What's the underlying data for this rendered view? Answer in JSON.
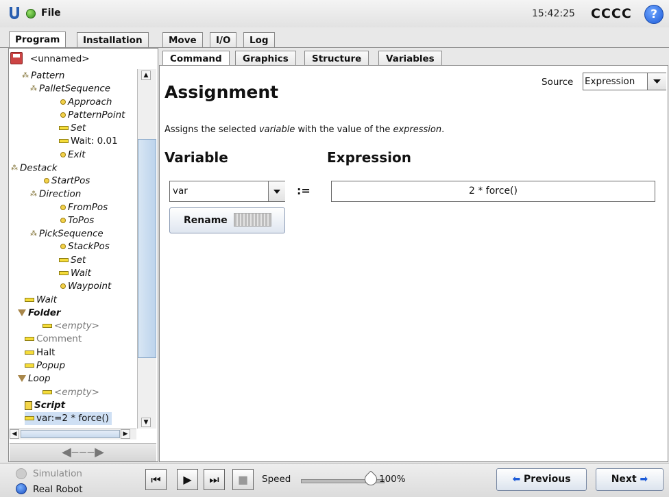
{
  "app": {
    "menu_file": "File",
    "clock": "15:42:25",
    "robot_name": "CCCC",
    "help": "?"
  },
  "main_tabs": [
    "Program",
    "Installation",
    "Move",
    "I/O",
    "Log"
  ],
  "program": {
    "name": "<unnamed>"
  },
  "tree": [
    {
      "label": "Pattern",
      "icon": "pattern-icon",
      "style": "italic"
    },
    {
      "label": "PalletSequence",
      "icon": "pattern-icon",
      "style": "italic"
    },
    {
      "label": "Approach",
      "icon": "waypoint-icon",
      "style": "italic"
    },
    {
      "label": "PatternPoint",
      "icon": "waypoint-icon",
      "style": "italic"
    },
    {
      "label": "Set",
      "icon": "command-icon",
      "style": "italic"
    },
    {
      "label": "Wait: 0.01",
      "icon": "command-icon",
      "style": "normal"
    },
    {
      "label": "Exit",
      "icon": "waypoint-icon",
      "style": "italic"
    },
    {
      "label": "Destack",
      "icon": "pattern-icon",
      "style": "italic"
    },
    {
      "label": "StartPos",
      "icon": "waypoint-icon",
      "style": "italic"
    },
    {
      "label": "Direction",
      "icon": "pattern-icon",
      "style": "italic"
    },
    {
      "label": "FromPos",
      "icon": "waypoint-icon",
      "style": "italic"
    },
    {
      "label": "ToPos",
      "icon": "waypoint-icon",
      "style": "italic"
    },
    {
      "label": "PickSequence",
      "icon": "pattern-icon",
      "style": "italic"
    },
    {
      "label": "StackPos",
      "icon": "waypoint-icon",
      "style": "italic"
    },
    {
      "label": "Set",
      "icon": "command-icon",
      "style": "italic"
    },
    {
      "label": "Wait",
      "icon": "command-icon",
      "style": "italic"
    },
    {
      "label": "Waypoint",
      "icon": "waypoint-icon",
      "style": "italic"
    },
    {
      "label": "Wait",
      "icon": "command-icon",
      "style": "italic"
    },
    {
      "label": "Folder",
      "icon": "folder-icon",
      "style": "bold-italic"
    },
    {
      "label": "<empty>",
      "icon": "command-icon",
      "style": "gray-italic"
    },
    {
      "label": "Comment",
      "icon": "command-icon",
      "style": "gray"
    },
    {
      "label": "Halt",
      "icon": "command-icon",
      "style": "normal"
    },
    {
      "label": "Popup",
      "icon": "command-icon",
      "style": "italic"
    },
    {
      "label": "Loop",
      "icon": "folder-icon",
      "style": "italic"
    },
    {
      "label": "<empty>",
      "icon": "command-icon",
      "style": "gray-italic"
    },
    {
      "label": "Script",
      "icon": "script-icon",
      "style": "bold-italic"
    },
    {
      "label": "var:=2 * force()",
      "icon": "command-icon",
      "style": "selected"
    }
  ],
  "sub_tabs": [
    "Command",
    "Graphics",
    "Structure",
    "Variables"
  ],
  "command": {
    "title": "Assignment",
    "desc_prefix": "Assigns the selected ",
    "desc_var": "variable",
    "desc_mid": " with the value of the ",
    "desc_expr": "expression",
    "desc_suffix": ".",
    "source_label": "Source",
    "source_value": "Expression",
    "variable_heading": "Variable",
    "expression_heading": "Expression",
    "variable_value": "var",
    "assign_op": ":=",
    "expression_value": "2 * force()",
    "rename_label": "Rename"
  },
  "bottom": {
    "simulation": "Simulation",
    "real_robot": "Real Robot",
    "speed_label": "Speed",
    "speed_value": "100%",
    "speed_fraction": 1.0,
    "previous": "Previous",
    "next": "Next"
  },
  "colors": {
    "accent": "#1d5bd8",
    "selection": "#cfe0f4"
  }
}
